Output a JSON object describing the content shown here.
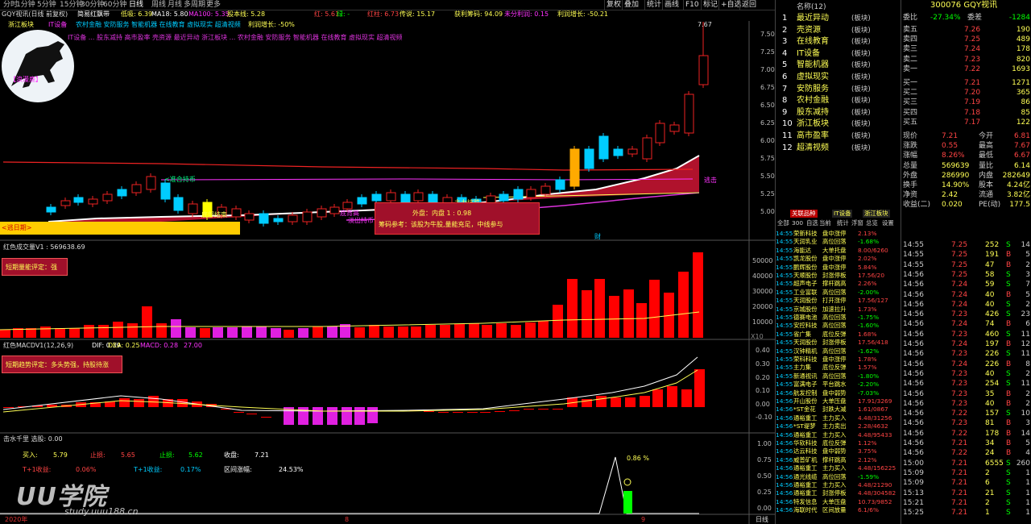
{
  "toolbar": {
    "periods": [
      "分时",
      "1分钟",
      "5分钟",
      "15分钟",
      "30分钟",
      "60分钟",
      "日线",
      "周线",
      "月线",
      "多周期",
      "更多"
    ],
    "active_period": "日线",
    "right_buttons": [
      "复权",
      "叠加",
      "统计",
      "画线",
      "F10",
      "标记",
      "+自选",
      "返回"
    ]
  },
  "header": {
    "stock_line": "GQY视讯(日线 前复权)",
    "formula": "简易红飘带",
    "low_label": "低吸: 6.39",
    "ma18": "MA18: 5.80",
    "ma100": "MA100: 5.35",
    "loss_label": "股本线: 5.28",
    "red_label": "红: 5.61",
    "green_label": "绿: -",
    "red_bar": "红柱: 6.73",
    "chuanshuo": "传说: 15.17",
    "profit_chip": "获利筹码: 94.09",
    "unallocated": "未分利润: 0.15",
    "profit_growth": "利润增长: -50.21",
    "concepts_label1": "浙江板块",
    "concepts_label2": "IT设备",
    "concepts_line1": "农村金融 安防服务 智能机器 在线教育 虚拟现实 超清视频",
    "concepts_line2": "IT设备 ... 股东减持 高市盈率 壳资源 最近异动 浙江板块 ... 农村金融 安防服务 智能机器 在线教育 虚拟现实 超清视频",
    "profit_label": "利润增长: -50%",
    "logo_text": "【浪漫鹿】"
  },
  "main_chart": {
    "y_ticks": [
      "7.50",
      "7.25",
      "7.00",
      "6.75",
      "6.50",
      "6.25",
      "6.00",
      "5.75",
      "5.50",
      "5.25",
      "5.00"
    ],
    "high_label": "7.67",
    "annotations": {
      "stay_label": "<准合持币",
      "end_label": "底部结束",
      "buy_label": "底背高",
      "outer_inner": "外盘：内盘  1 : 0.98",
      "chip_ref": "筹码参考：该股为牛股,量能充足，中线参与",
      "zhuli": "主力抗跌",
      "yellow_left": "<逃日期>",
      "chuji": "逃击",
      "cai": "财",
      "hold_label": "淡出持币"
    }
  },
  "volume_chart": {
    "title": "红色成交量V1 : 569638.69",
    "eval": "短期量能评定：强",
    "y_ticks": [
      "50000",
      "40000",
      "30000",
      "20000",
      "10000"
    ],
    "x10": "X10"
  },
  "macd_chart": {
    "title": "红色MACDV1(12,26,9)",
    "dif": "DIF: 0.39",
    "dea": "DEA: 0.25",
    "macd": "MACD: 0.28",
    "val": "27.00",
    "eval": "短期趋势评定：多头势强，持股待涨",
    "y_ticks": [
      "0.40",
      "0.30",
      "0.20",
      "0.10",
      "0.00",
      "-0.10"
    ]
  },
  "sub_chart": {
    "title": "击水千里  选股: 0.00",
    "buy": "买入:",
    "buy_val": "5.79",
    "stop_loss": "止损:",
    "stop_loss_val": "5.65",
    "take_profit": "止损:",
    "take_profit_val": "5.62",
    "close": "收盘:",
    "close_val": "7.21",
    "t1_label": "T+1收益:",
    "t1_val": "0.06%",
    "t1b_label": "T+1收益:",
    "t1b_val": "0.17%",
    "range_label": "区间涨幅:",
    "range_val": "24.53%",
    "pct": "0.86 %",
    "y_ticks": [
      "1.00",
      "0.75",
      "0.50",
      "0.25",
      "0.00"
    ]
  },
  "x_axis": {
    "left": "2020年",
    "m8": "8",
    "m9": "9",
    "period": "日线"
  },
  "watermark": {
    "main": "UU学院",
    "url": "study.uuu188.cn"
  },
  "list_panel": {
    "header": "名称(12)",
    "items": [
      {
        "n": "1",
        "name": "最近异动",
        "tag": "(板块)"
      },
      {
        "n": "2",
        "name": "壳资源",
        "tag": "(板块)"
      },
      {
        "n": "3",
        "name": "在线教育",
        "tag": "(板块)"
      },
      {
        "n": "4",
        "name": "IT设备",
        "tag": "(板块)"
      },
      {
        "n": "5",
        "name": "智能机器",
        "tag": "(板块)"
      },
      {
        "n": "6",
        "name": "虚拟现实",
        "tag": "(板块)"
      },
      {
        "n": "7",
        "name": "安防服务",
        "tag": "(板块)"
      },
      {
        "n": "8",
        "name": "农村金融",
        "tag": "(板块)"
      },
      {
        "n": "9",
        "name": "股东减持",
        "tag": "(板块)"
      },
      {
        "n": "10",
        "name": "浙江板块",
        "tag": "(板块)"
      },
      {
        "n": "11",
        "name": "高市盈率",
        "tag": "(板块)"
      },
      {
        "n": "12",
        "name": "超清视频",
        "tag": "(板块)"
      }
    ]
  },
  "news_panel": {
    "tabs": [
      "关联品种",
      "IT设备",
      "浙江板块"
    ],
    "subtabs": [
      "全部",
      "300",
      "自选",
      "当前",
      "统计",
      "浮窗",
      "总览",
      "设置"
    ],
    "rows": [
      [
        "14:55",
        "荣新科技",
        "盘中涨停",
        "2.13%"
      ],
      [
        "14:55",
        "天润乳业",
        "高位回落",
        "-1.68%"
      ],
      [
        "14:55",
        "海能达",
        "大单托盘",
        "8.00/6260"
      ],
      [
        "14:55",
        "凯龙股份",
        "盘中涨停",
        "2.02%"
      ],
      [
        "14:55",
        "鹏辉股份",
        "盘中涨停",
        "5.84%"
      ],
      [
        "14:55",
        "天顺股份",
        "封涨停板",
        "17.56/20"
      ],
      [
        "14:55",
        "超声电子",
        "撑杆跳高",
        "2.26%"
      ],
      [
        "14:55",
        "工业富联",
        "高位回落",
        "-2.00%"
      ],
      [
        "14:55",
        "天润股份",
        "打开涨停",
        "17.56/127"
      ],
      [
        "14:55",
        "京城股份",
        "加速拉升",
        "1.73%"
      ],
      [
        "14:55",
        "德赛电池",
        "高位回落",
        "-1.75%"
      ],
      [
        "14:55",
        "安控科技",
        "高位回落",
        "-1.60%"
      ],
      [
        "14:55",
        "省广集",
        "底位反弹",
        "1.68%"
      ],
      [
        "14:55",
        "天润股份",
        "封涨停板",
        "17.56/418"
      ],
      [
        "14:55",
        "汉钟精机",
        "高位回落",
        "-1.62%"
      ],
      [
        "14:55",
        "荣科科技",
        "盘中涨停",
        "1.78%"
      ],
      [
        "14:55",
        "主力集",
        "底位反弹",
        "1.57%"
      ],
      [
        "14:55",
        "新通视讯",
        "高位回落",
        "-1.80%"
      ],
      [
        "14:55",
        "富满电子",
        "平台跳水",
        "-2.20%"
      ],
      [
        "14:56",
        "航发控制",
        "盘中弱势",
        "-7.03%"
      ],
      [
        "14:56",
        "开山股份",
        "大单压盘",
        "17.91/3269"
      ],
      [
        "14:56",
        "*ST金花",
        "封跌大减",
        "1.61/0867"
      ],
      [
        "14:56",
        "通裕重工",
        "主力买入",
        "4.48/31256"
      ],
      [
        "14:56",
        "*ST堤梦",
        "主力卖出",
        "2.28/4632"
      ],
      [
        "14:56",
        "通裕重工",
        "主力买入",
        "4.48/95433"
      ],
      [
        "14:56",
        "华软科技",
        "底位反弹",
        "1.12%"
      ],
      [
        "14:56",
        "达云科技",
        "盘中弱势",
        "3.75%"
      ],
      [
        "14:56",
        "威普矿机",
        "撑杆跳高",
        "2.12%"
      ],
      [
        "14:56",
        "通裕重工",
        "主力买入",
        "4.48/156225"
      ],
      [
        "14:56",
        "通光线缆",
        "高位回落",
        "-1.59%"
      ],
      [
        "14:56",
        "通裕重工",
        "主力买入",
        "4.48/21290"
      ],
      [
        "14:56",
        "通裕重工",
        "封涨停板",
        "4.48/304582"
      ],
      [
        "14:56",
        "特发信息",
        "大单压盘",
        "10.73/9852"
      ],
      [
        "14:56",
        "海联时代",
        "区间放量",
        "6.1/6%"
      ]
    ]
  },
  "quote_panel": {
    "code": "300076 GQY视讯",
    "weibi_label": "委比",
    "weibi_val": "-27.34%",
    "weicha_label": "委差",
    "weicha_val": "-1284",
    "sells": [
      {
        "l": "卖五",
        "p": "7.26",
        "v": "190"
      },
      {
        "l": "卖四",
        "p": "7.25",
        "v": "489"
      },
      {
        "l": "卖三",
        "p": "7.24",
        "v": "178"
      },
      {
        "l": "卖二",
        "p": "7.23",
        "v": "820"
      },
      {
        "l": "卖一",
        "p": "7.22",
        "v": "1693"
      }
    ],
    "buys": [
      {
        "l": "买一",
        "p": "7.21",
        "v": "1271"
      },
      {
        "l": "买二",
        "p": "7.20",
        "v": "365"
      },
      {
        "l": "买三",
        "p": "7.19",
        "v": "86"
      },
      {
        "l": "买四",
        "p": "7.18",
        "v": "85"
      },
      {
        "l": "买五",
        "p": "7.17",
        "v": "122"
      }
    ],
    "stats": [
      {
        "a": "现价",
        "av": "7.21",
        "b": "今开",
        "bv": "6.81"
      },
      {
        "a": "涨跌",
        "av": "0.55",
        "b": "最高",
        "bv": "7.67"
      },
      {
        "a": "涨幅",
        "av": "8.26%",
        "b": "最低",
        "bv": "6.67"
      },
      {
        "a": "总量",
        "av": "569639",
        "b": "量比",
        "bv": "6.14"
      },
      {
        "a": "外盘",
        "av": "286990",
        "b": "内盘",
        "bv": "282649"
      },
      {
        "a": "换手",
        "av": "14.90%",
        "b": "股本",
        "bv": "4.24亿"
      },
      {
        "a": "净资",
        "av": "2.42",
        "b": "流通",
        "bv": "3.82亿"
      },
      {
        "a": "收益(二)",
        "av": "0.020",
        "b": "PE(动)",
        "bv": "177.5"
      }
    ],
    "ticks": [
      [
        "14:55",
        "7.25",
        "252",
        "S",
        "14"
      ],
      [
        "14:55",
        "7.25",
        "191",
        "B",
        "5"
      ],
      [
        "14:55",
        "7.25",
        "47",
        "B",
        "2"
      ],
      [
        "14:56",
        "7.25",
        "58",
        "S",
        "3"
      ],
      [
        "14:56",
        "7.24",
        "59",
        "S",
        "7"
      ],
      [
        "14:56",
        "7.24",
        "40",
        "B",
        "5"
      ],
      [
        "14:56",
        "7.24",
        "40",
        "S",
        "2"
      ],
      [
        "14:56",
        "7.23",
        "426",
        "S",
        "23"
      ],
      [
        "14:56",
        "7.24",
        "74",
        "B",
        "6"
      ],
      [
        "14:56",
        "7.23",
        "460",
        "S",
        "11"
      ],
      [
        "14:56",
        "7.24",
        "197",
        "B",
        "12"
      ],
      [
        "14:56",
        "7.23",
        "226",
        "S",
        "11"
      ],
      [
        "14:56",
        "7.24",
        "226",
        "B",
        "8"
      ],
      [
        "14:56",
        "7.23",
        "40",
        "S",
        "2"
      ],
      [
        "14:56",
        "7.23",
        "254",
        "S",
        "11"
      ],
      [
        "14:56",
        "7.23",
        "35",
        "B",
        "2"
      ],
      [
        "14:56",
        "7.23",
        "40",
        "B",
        "2"
      ],
      [
        "14:56",
        "7.22",
        "157",
        "S",
        "10"
      ],
      [
        "14:56",
        "7.23",
        "81",
        "B",
        "3"
      ],
      [
        "14:56",
        "7.22",
        "178",
        "B",
        "14"
      ],
      [
        "14:56",
        "7.21",
        "34",
        "B",
        "5"
      ],
      [
        "14:56",
        "7.22",
        "24",
        "B",
        "4"
      ],
      [
        "15:00",
        "7.21",
        "6555",
        "S",
        "260"
      ],
      [
        "15:09",
        "7.21",
        "2",
        "S",
        "1"
      ],
      [
        "15:09",
        "7.21",
        "6",
        "S",
        "1"
      ],
      [
        "15:13",
        "7.21",
        "21",
        "S",
        "1"
      ],
      [
        "15:21",
        "7.21",
        "2",
        "S",
        "1"
      ],
      [
        "15:25",
        "7.21",
        "1",
        "S",
        "1"
      ]
    ]
  }
}
